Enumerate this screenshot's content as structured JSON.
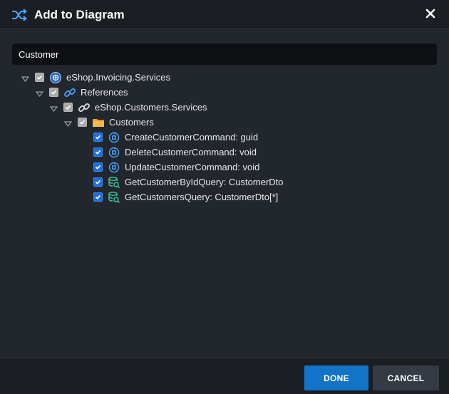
{
  "dialog": {
    "title": "Add to Diagram",
    "icon": "shuffle-icon",
    "close_icon": "close-icon"
  },
  "search": {
    "value": "Customer",
    "placeholder": ""
  },
  "tree": {
    "root": {
      "label": "eShop.Invoicing.Services",
      "icon": "service-globe-icon",
      "checked": "indeterminate",
      "expanded": true
    },
    "references": {
      "label": "References",
      "icon": "link-icon",
      "checked": "indeterminate",
      "expanded": true
    },
    "package": {
      "label": "eShop.Customers.Services",
      "icon": "chain-link-icon",
      "checked": "indeterminate",
      "expanded": true
    },
    "folder": {
      "label": "Customers",
      "icon": "folder-icon",
      "checked": "indeterminate",
      "expanded": true
    },
    "items": [
      {
        "label": "CreateCustomerCommand: guid",
        "icon": "command-icon",
        "checked": true
      },
      {
        "label": "DeleteCustomerCommand: void",
        "icon": "command-icon",
        "checked": true
      },
      {
        "label": "UpdateCustomerCommand: void",
        "icon": "command-icon",
        "checked": true
      },
      {
        "label": "GetCustomerByIdQuery: CustomerDto",
        "icon": "query-icon",
        "checked": true
      },
      {
        "label": "GetCustomersQuery: CustomerDto[*]",
        "icon": "query-icon",
        "checked": true
      }
    ]
  },
  "footer": {
    "done_label": "DONE",
    "cancel_label": "CANCEL"
  },
  "colors": {
    "background": "#22262d",
    "header": "#1b1e23",
    "primary_button": "#1274c8",
    "secondary_button": "#353b44",
    "checkbox_checked": "#1e6fdc",
    "checkbox_partial": "#a9a9a9"
  }
}
